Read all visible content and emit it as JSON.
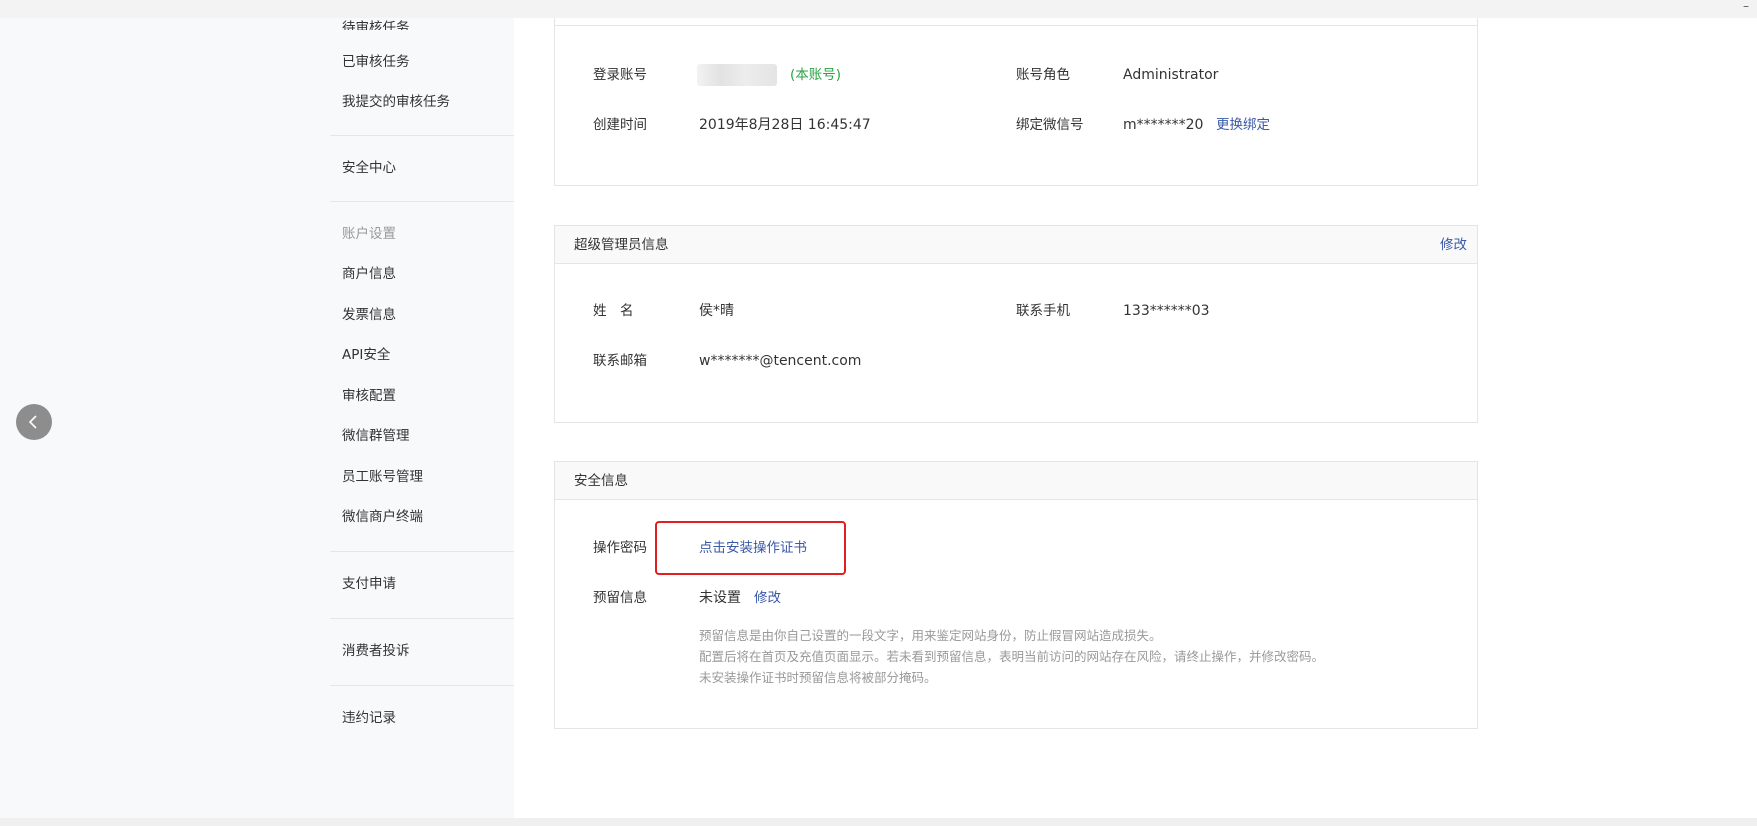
{
  "window": {
    "minimize_glyph": "–"
  },
  "sidebar": {
    "top_cut_item": "待审核任务",
    "items_group1": [
      "已审核任务",
      "我提交的审核任务"
    ],
    "security_center": "安全中心",
    "account_settings_header": "账户设置",
    "account_items": [
      "商户信息",
      "发票信息",
      "API安全",
      "审核配置",
      "微信群管理",
      "员工账号管理",
      "微信商户终端"
    ],
    "pay_apply": "支付申请",
    "consumer_complaints": "消费者投诉",
    "violation_records": "违约记录",
    "back_icon": "chevron-left-icon"
  },
  "account_panel": {
    "login_account_label": "登录账号",
    "login_account_tag": "(本账号)",
    "role_label": "账号角色",
    "role_value": "Administrator",
    "created_label": "创建时间",
    "created_value": "2019年8月28日 16:45:47",
    "wechat_label": "绑定微信号",
    "wechat_value": "m*******20",
    "wechat_action": "更换绑定"
  },
  "admin_panel": {
    "title": "超级管理员信息",
    "edit_label": "修改",
    "name_label": "姓　名",
    "name_value": "侯*晴",
    "phone_label": "联系手机",
    "phone_value": "133******03",
    "email_label": "联系邮箱",
    "email_value": "w*******@tencent.com"
  },
  "security_panel": {
    "title": "安全信息",
    "op_password_label": "操作密码",
    "op_password_action": "点击安装操作证书",
    "reserved_label": "预留信息",
    "reserved_value": "未设置",
    "reserved_action": "修改",
    "hints": [
      "预留信息是由你自己设置的一段文字，用来鉴定网站身份，防止假冒网站造成损失。",
      "配置后将在首页及充值页面显示。若未看到预留信息，表明当前访问的网站存在风险，请终止操作，并修改密码。",
      "未安装操作证书时预留信息将被部分掩码。"
    ]
  },
  "colors": {
    "link": "#3a5aa8",
    "highlight": "#e02020",
    "tag_green": "#2ba245"
  }
}
